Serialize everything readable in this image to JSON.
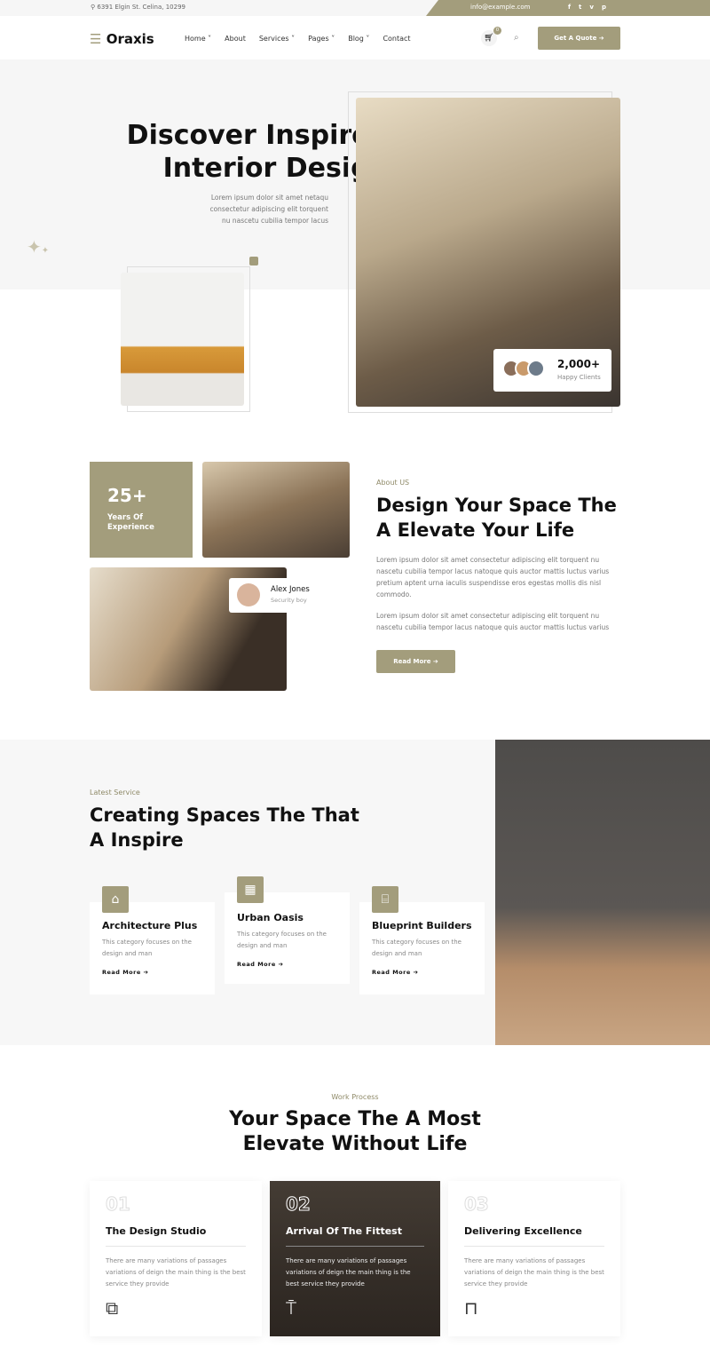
{
  "topbar": {
    "address": "6391 Elgin St. Celina, 10299",
    "email": "info@example.com",
    "social": [
      "f",
      "t",
      "v",
      "p"
    ]
  },
  "header": {
    "logo": "Oraxis",
    "nav": [
      {
        "label": "Home",
        "dropdown": true
      },
      {
        "label": "About"
      },
      {
        "label": "Services",
        "dropdown": true
      },
      {
        "label": "Pages",
        "dropdown": true
      },
      {
        "label": "Blog",
        "dropdown": true
      },
      {
        "label": "Contact"
      }
    ],
    "cart_count": "0",
    "quote_label": "Get A Quote ➔"
  },
  "hero": {
    "title_line1": "Discover Inspired",
    "title_line2": "Interior Design",
    "text": "Lorem ipsum dolor sit amet netaqu consectetur adipiscing elit torquent nu nascetu cubilia tempor lacus",
    "clients_count": "2,000+",
    "clients_label": "Happy Clients"
  },
  "about": {
    "years": "25+",
    "years_label": "Years Of Experience",
    "person_name": "Alex Jones",
    "person_role": "Security boy",
    "tag": "About US",
    "title": "Design Your Space The A Elevate Your Life",
    "p1": "Lorem ipsum dolor sit amet consectetur adipiscing elit torquent nu nascetu cubilia tempor lacus natoque quis auctor mattis luctus varius pretium aptent urna iaculis suspendisse eros egestas mollis dis nisl commodo.",
    "p2": "Lorem ipsum dolor sit amet consectetur adipiscing elit torquent nu nascetu cubilia tempor lacus natoque quis auctor mattis luctus varius",
    "button": "Read More ➔"
  },
  "services": {
    "tag": "Latest Service",
    "title": "Creating Spaces The That A Inspire",
    "cards": [
      {
        "icon": "bed-icon",
        "title": "Architecture Plus",
        "text": "This category focuses on the design and man",
        "link": "Read More ➔"
      },
      {
        "icon": "blueprint-icon",
        "title": "Urban Oasis",
        "text": "This category focuses on the design and man",
        "link": "Read More ➔"
      },
      {
        "icon": "window-icon",
        "title": "Blueprint Builders",
        "text": "This category focuses on the design and man",
        "link": "Read More ➔"
      }
    ]
  },
  "process": {
    "tag": "Work Process",
    "title_line1": "Your Space The A Most",
    "title_line2": "Elevate Without Life",
    "steps": [
      {
        "num": "01",
        "title": "The Design Studio",
        "text": "There are many variations of passages variations of deign the main thing is the best service they provide",
        "icon": "cross-shape-icon"
      },
      {
        "num": "02",
        "title": "Arrival Of The Fittest",
        "text": "There are many variations of passages variations of deign the main thing is the best service they provide",
        "icon": "paint-roller-icon"
      },
      {
        "num": "03",
        "title": "Delivering Excellence",
        "text": "There are many variations of passages variations of deign the main thing is the best service they provide",
        "icon": "desk-icon"
      }
    ]
  },
  "colors": {
    "accent": "#a39d7c"
  }
}
